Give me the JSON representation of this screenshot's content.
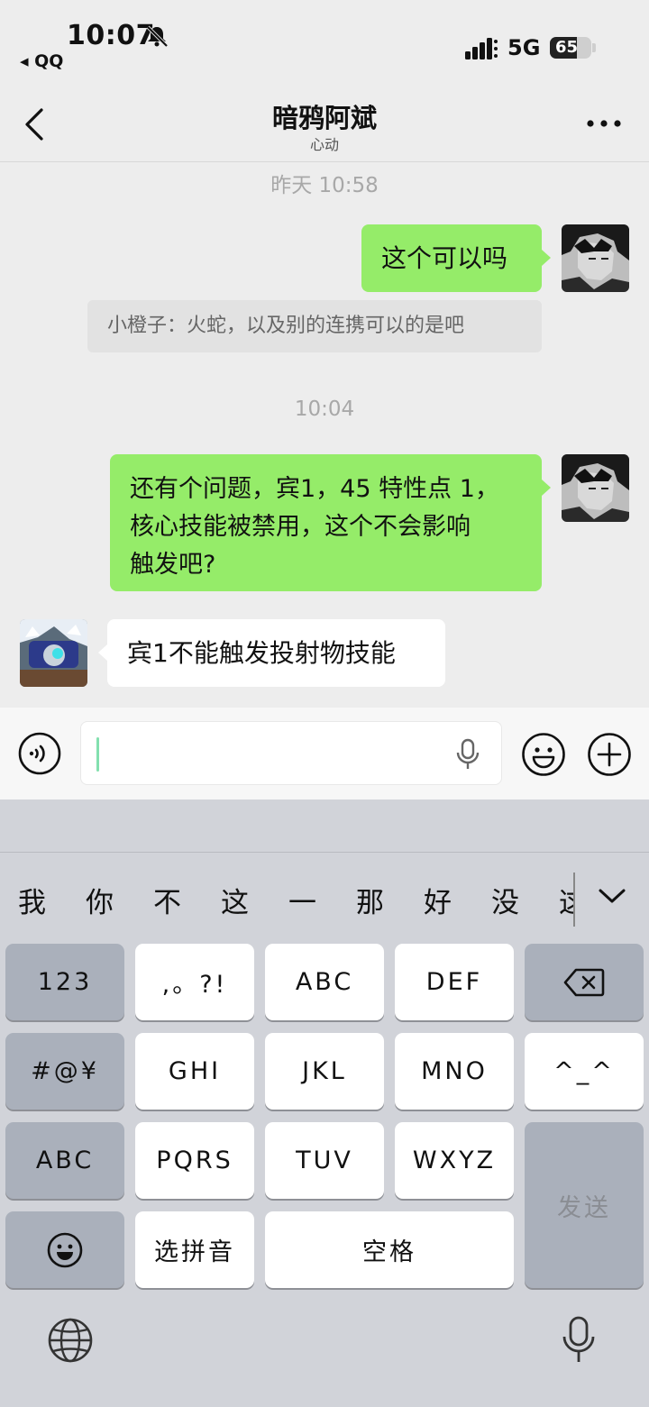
{
  "status_bar": {
    "time": "10:07",
    "back_app": "◂ QQ",
    "network": "5G",
    "battery": "65",
    "battery_level": 0.65
  },
  "nav": {
    "title": "暗鸦阿斌",
    "subtitle": "心动"
  },
  "messages": {
    "ts1": "昨天 10:58",
    "msg1": "这个可以吗",
    "quote": "小橙子：火蛇，以及别的连携可以的是吧",
    "ts2": "10:04",
    "msg2_lines": [
      "还有个问题，宾1，45 特性点 1，",
      "核心技能被禁用，这个不会影响",
      "触发吧?"
    ],
    "msg3": "宾1不能触发投射物技能"
  },
  "keyboard": {
    "candidates": [
      "我",
      "你",
      "不",
      "这",
      "一",
      "那",
      "好",
      "没",
      "这"
    ],
    "keys": {
      "k123": "123",
      "punct": ",。?!",
      "abc": "ABC",
      "def": "DEF",
      "symbols": "#@¥",
      "ghi": "GHI",
      "jkl": "JKL",
      "mno": "MNO",
      "kaomoji": "^_^",
      "abc_switch": "ABC",
      "pqrs": "PQRS",
      "tuv": "TUV",
      "wxyz": "WXYZ",
      "send": "发送",
      "pinyin": "选拼音",
      "space": "空格"
    }
  },
  "colors": {
    "my_bubble": "#95ec69",
    "their_bubble": "#ffffff",
    "background": "#ededed",
    "keyboard_bg": "#d1d3d9"
  }
}
